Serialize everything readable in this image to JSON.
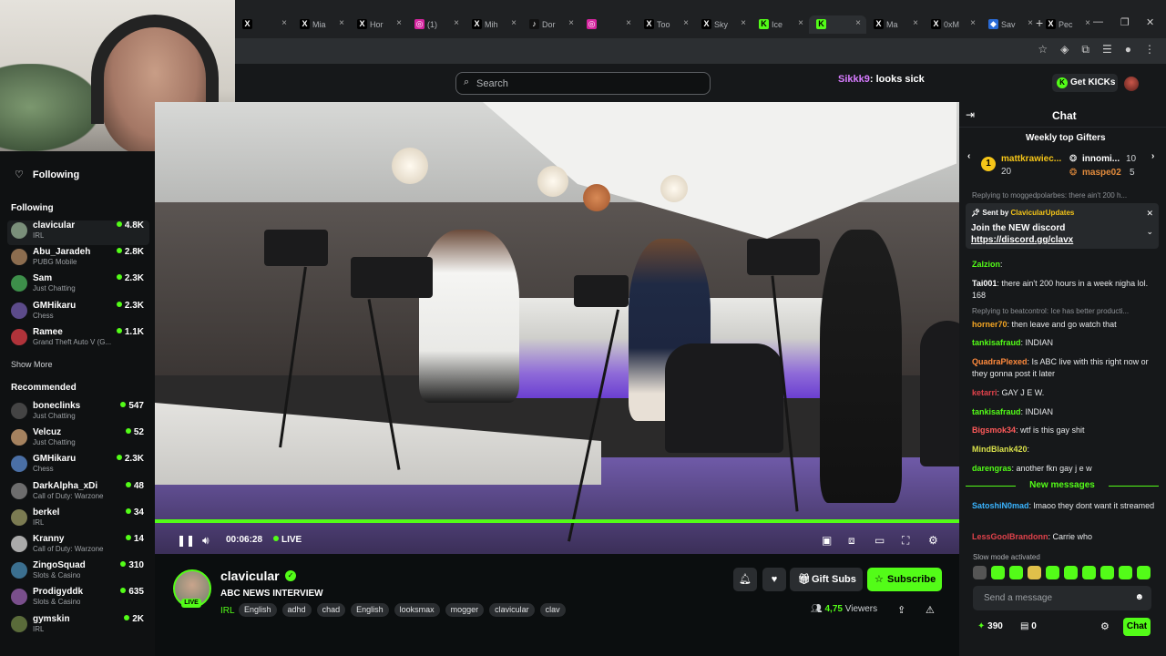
{
  "browser": {
    "tabs": [
      {
        "label": "",
        "fav": "X",
        "color": "#000000"
      },
      {
        "label": "Mia",
        "fav": "X",
        "color": "#000000"
      },
      {
        "label": "Hor",
        "fav": "X",
        "color": "#000000"
      },
      {
        "label": "(1)",
        "fav": "◎",
        "color": "#d6249f"
      },
      {
        "label": "Mih",
        "fav": "X",
        "color": "#000000"
      },
      {
        "label": "Dor",
        "fav": "♪",
        "color": "#111111"
      },
      {
        "label": "",
        "fav": "◎",
        "color": "#d6249f"
      },
      {
        "label": "Too",
        "fav": "X",
        "color": "#000000"
      },
      {
        "label": "Sky",
        "fav": "X",
        "color": "#000000"
      },
      {
        "label": "Ice",
        "fav": "K",
        "color": "#53fc18"
      },
      {
        "label": "",
        "fav": "K",
        "color": "#53fc18"
      },
      {
        "label": "Ma",
        "fav": "X",
        "color": "#000000"
      },
      {
        "label": "0xM",
        "fav": "X",
        "color": "#000000"
      },
      {
        "label": "Sav",
        "fav": "◆",
        "color": "#2a6bd6"
      },
      {
        "label": "Pec",
        "fav": "X",
        "color": "#000000"
      }
    ]
  },
  "header": {
    "search_placeholder": "Search",
    "recent_user": "Sikkk9",
    "recent_text": ": looks sick",
    "get_kicks": "Get KICKs"
  },
  "sidebar": {
    "following_title": "Following",
    "following_header": "Following",
    "following": [
      {
        "name": "clavicular",
        "category": "IRL",
        "viewers": "4.8K"
      },
      {
        "name": "Abu_Jaradeh",
        "category": "PUBG Mobile",
        "viewers": "2.8K"
      },
      {
        "name": "Sam",
        "category": "Just Chatting",
        "viewers": "2.3K"
      },
      {
        "name": "GMHikaru",
        "category": "Chess",
        "viewers": "2.3K"
      },
      {
        "name": "Ramee",
        "category": "Grand Theft Auto V (G...",
        "viewers": "1.1K"
      }
    ],
    "show_more": "Show More",
    "recommended_header": "Recommended",
    "recommended": [
      {
        "name": "boneclinks",
        "category": "Just Chatting",
        "viewers": "547"
      },
      {
        "name": "Velcuz",
        "category": "Just Chatting",
        "viewers": "52"
      },
      {
        "name": "GMHikaru",
        "category": "Chess",
        "viewers": "2.3K"
      },
      {
        "name": "DarkAlpha_xDi",
        "category": "Call of Duty: Warzone",
        "viewers": "48"
      },
      {
        "name": "berkel",
        "category": "IRL",
        "viewers": "34"
      },
      {
        "name": "Kranny",
        "category": "Call of Duty: Warzone",
        "viewers": "14"
      },
      {
        "name": "ZingoSquad",
        "category": "Slots & Casino",
        "viewers": "310"
      },
      {
        "name": "Prodigyddk",
        "category": "Slots & Casino",
        "viewers": "635"
      },
      {
        "name": "gymskin",
        "category": "IRL",
        "viewers": "2K"
      }
    ]
  },
  "player": {
    "time": "00:06:28",
    "live": "LIVE",
    "progress": 1.0
  },
  "stream": {
    "streamer": "clavicular",
    "live_badge": "LIVE",
    "title": "ABC NEWS INTERVIEW",
    "category": "IRL",
    "tags": [
      "English",
      "adhd",
      "chad",
      "English",
      "looksmax",
      "mogger",
      "clavicular",
      "clav"
    ],
    "gift_subs": "Gift Subs",
    "subscribe": "Subscribe",
    "viewers_count": "4,75",
    "viewers_label": "Viewers"
  },
  "chat": {
    "title": "Chat",
    "gifters_title": "Weekly top Gifters",
    "gifters": [
      {
        "rank": "1",
        "name": "mattkrawiec...",
        "count": "20"
      },
      {
        "rank": "2",
        "name": "innomi...",
        "count": "10"
      },
      {
        "rank": "3",
        "name": "maspe02",
        "count": "5"
      }
    ],
    "reply_top": "Replying to moggedpolarbes: there ain't 200 h...",
    "pinned_by_prefix": "Sent by",
    "pinned_by": "ClavicularUpdates",
    "pinned_line1": "Join the NEW discord",
    "pinned_line2": "https://discord.gg/clavx",
    "messages": [
      {
        "user": "Zalzion",
        "color": "#53fc18",
        "text": ":"
      },
      {
        "user": "Tai001",
        "color": "#ffffff",
        "text": ": there ain't 200 hours in a week nigha lol. 168"
      },
      {
        "reply": "Replying to beatcontrol: Ice has better producti..."
      },
      {
        "user": "horner70",
        "color": "#f5a623",
        "text": ": then leave and go watch that"
      },
      {
        "user": "tankisafraud",
        "color": "#53fc18",
        "text": ": INDIAN"
      },
      {
        "user": "QuadraPlexed",
        "color": "#ff8a3d",
        "text": ": Is ABC live with this right now or they gonna post it later"
      },
      {
        "user": "ketarri",
        "color": "#e0424b",
        "text": ": GAY J E W."
      },
      {
        "user": "tankisafraud",
        "color": "#53fc18",
        "text": ": INDIAN"
      },
      {
        "user": "Bigsmok34",
        "color": "#ff5a5a",
        "text": ": wtf is this gay shit"
      },
      {
        "user": "MindBlank420",
        "color": "#d8e04a",
        "text": ":"
      },
      {
        "user": "darengras",
        "color": "#53fc18",
        "text": ": another fkn gay j e w"
      }
    ],
    "new_messages": "New messages",
    "after_messages": [
      {
        "user": "SatoshiN0mad",
        "color": "#3ab4ff",
        "text": ": lmaoo they dont want it streamed"
      },
      {
        "user": "LessGoolBrandonn",
        "color": "#e0424b",
        "text": ": Carrie who"
      }
    ],
    "slow_mode": "Slow mode activated",
    "send_placeholder": "Send a message",
    "kicks_count": "390",
    "bag_count": "0",
    "chat_button": "Chat"
  }
}
